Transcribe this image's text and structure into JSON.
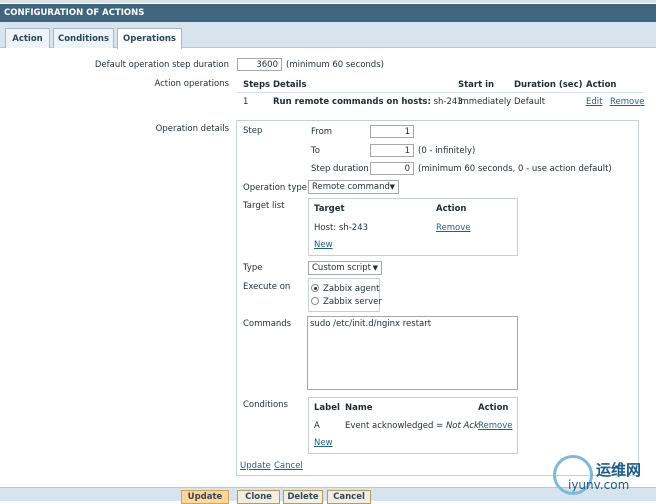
{
  "header": {
    "title": "CONFIGURATION OF ACTIONS"
  },
  "tabs": [
    {
      "label": "Action",
      "active": false
    },
    {
      "label": "Conditions",
      "active": false
    },
    {
      "label": "Operations",
      "active": true
    }
  ],
  "default_duration": {
    "label": "Default operation step duration",
    "value": "3600",
    "hint": "(minimum 60 seconds)"
  },
  "action_operations": {
    "label": "Action operations",
    "headers": {
      "steps": "Steps",
      "details": "Details",
      "start_in": "Start in",
      "duration": "Duration (sec)",
      "action": "Action"
    },
    "rows": [
      {
        "steps": "1",
        "details_bold": "Run remote commands on hosts:",
        "details_rest": "sh-243",
        "start_in": "Immediately",
        "duration": "Default",
        "edit": "Edit",
        "remove": "Remove"
      }
    ]
  },
  "operation_details": {
    "label": "Operation details",
    "step": {
      "label": "Step",
      "from_label": "From",
      "from_value": "1",
      "to_label": "To",
      "to_value": "1",
      "to_hint": "(0 - infinitely)",
      "duration_label": "Step duration",
      "duration_value": "0",
      "duration_hint": "(minimum 60 seconds, 0 - use action default)"
    },
    "operation_type": {
      "label": "Operation type",
      "value": "Remote command"
    },
    "target_list": {
      "label": "Target list",
      "headers": {
        "target": "Target",
        "action": "Action"
      },
      "rows": [
        {
          "target": "Host: sh-243",
          "action": "Remove"
        }
      ],
      "new": "New"
    },
    "type": {
      "label": "Type",
      "value": "Custom script"
    },
    "execute_on": {
      "label": "Execute on",
      "options": [
        {
          "label": "Zabbix agent",
          "selected": true
        },
        {
          "label": "Zabbix server",
          "selected": false
        }
      ]
    },
    "commands": {
      "label": "Commands",
      "value": "sudo /etc/init.d/nginx restart"
    },
    "conditions": {
      "label": "Conditions",
      "headers": {
        "label": "Label",
        "name": "Name",
        "action": "Action"
      },
      "rows": [
        {
          "label": "A",
          "name_prefix": "Event acknowledged = ",
          "name_value": "Not Ack",
          "action": "Remove"
        }
      ],
      "new": "New"
    },
    "update": "Update",
    "cancel": "Cancel"
  },
  "footer_buttons": {
    "update": "Update",
    "clone": "Clone",
    "delete": "Delete",
    "cancel": "Cancel"
  },
  "watermark": {
    "cn": "运维网",
    "en": "iyunv.com"
  },
  "colors": {
    "header_bg": "#40657f",
    "tab_bg": "#d8e4ed",
    "link": "#1f5f8a",
    "primary_button": "#ffd59a"
  }
}
